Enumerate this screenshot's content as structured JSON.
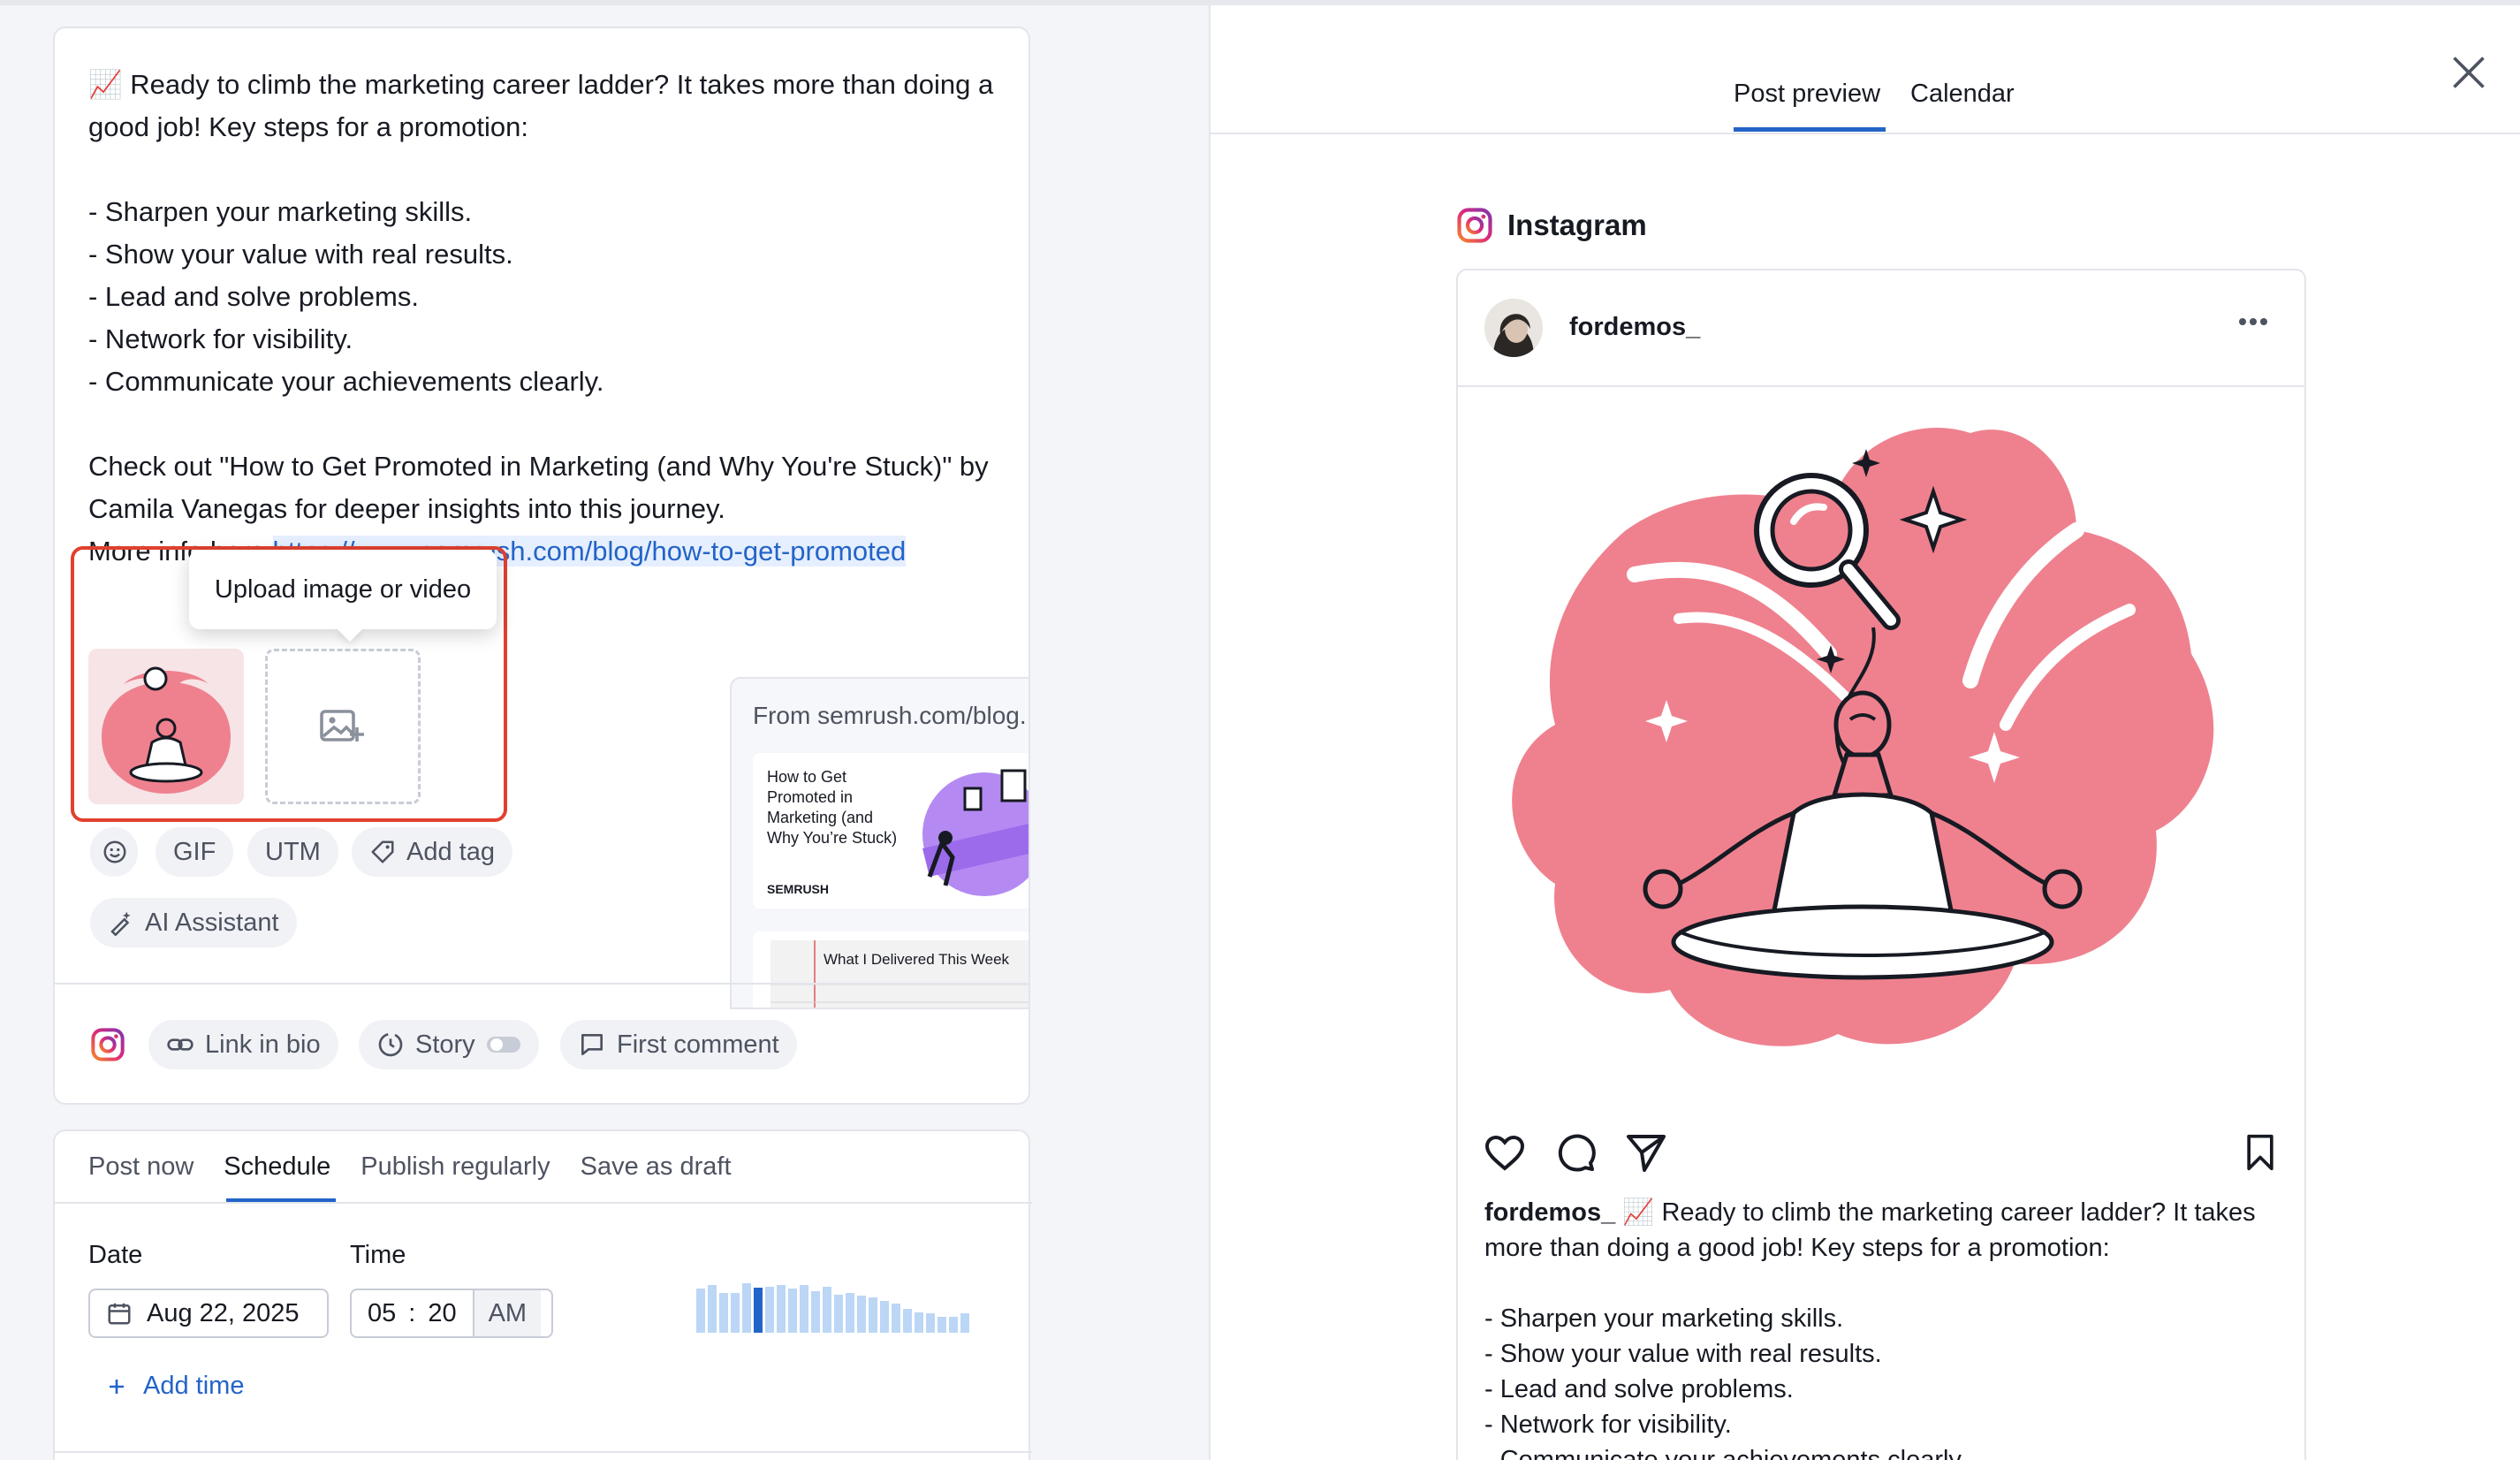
{
  "composer": {
    "emoji": "📈",
    "text_intro": " Ready to climb the marketing career ladder? It takes more than doing a good job! Key steps for a promotion:\n\n- Sharpen your marketing skills.\n- Show your value with real results.\n- Lead and solve problems.\n- Network for visibility.\n- Communicate your achievements clearly.\n\nCheck out \"How to Get Promoted in Marketing (and Why You're Stuck)\" by Camila Vanegas for deeper insights into this journey.\nMore info here ",
    "link_text": "https://www.semrush.com/blog/how-to-get-promoted",
    "tooltip": "Upload image or video",
    "toolbar": {
      "gif": "GIF",
      "utm": "UTM",
      "add_tag": "Add tag",
      "ai_assistant": "AI Assistant"
    },
    "link_preview": {
      "from": "From semrush.com/blog...",
      "card1_title": "How to Get Promoted in Marketing (and Why You’re Stuck)",
      "card1_brand": "SEMRUSH",
      "card2_title": "What I Delivered This Week"
    },
    "options": {
      "link_in_bio": "Link in bio",
      "story": "Story",
      "first_comment": "First comment"
    }
  },
  "schedule": {
    "tabs": [
      "Post now",
      "Schedule",
      "Publish regularly",
      "Save as draft"
    ],
    "active_tab": "Schedule",
    "date_label": "Date",
    "date_value": "Aug 22, 2025",
    "time_label": "Time",
    "hour": "05",
    "separator": ":",
    "minute": "20",
    "ampm": "AM",
    "add_time": "Add time",
    "activity_levels": [
      0.55,
      0.6,
      0.5,
      0.5,
      0.62,
      0.56,
      0.58,
      0.6,
      0.55,
      0.6,
      0.52,
      0.58,
      0.48,
      0.5,
      0.46,
      0.44,
      0.4,
      0.36,
      0.3,
      0.26,
      0.24,
      0.2,
      0.2,
      0.24
    ],
    "activity_highlight_index": 5
  },
  "preview": {
    "tabs": [
      "Post preview",
      "Calendar"
    ],
    "active_tab": "Post preview",
    "network": "Instagram",
    "username": "fordemos_",
    "caption": " 📈 Ready to climb the marketing career ladder? It takes more than doing a good job! Key steps for a promotion:\n\n- Sharpen your marketing skills.\n- Show your value with real results.\n- Lead and solve problems.\n- Network for visibility.\n- Communicate your achievements clearly."
  },
  "colors": {
    "accent": "#2364c8",
    "highlight_border": "#e0412f",
    "illustration_pink": "#ef818f",
    "instagram_gradient": [
      "#f58529",
      "#dd2a7b",
      "#8134af"
    ]
  }
}
